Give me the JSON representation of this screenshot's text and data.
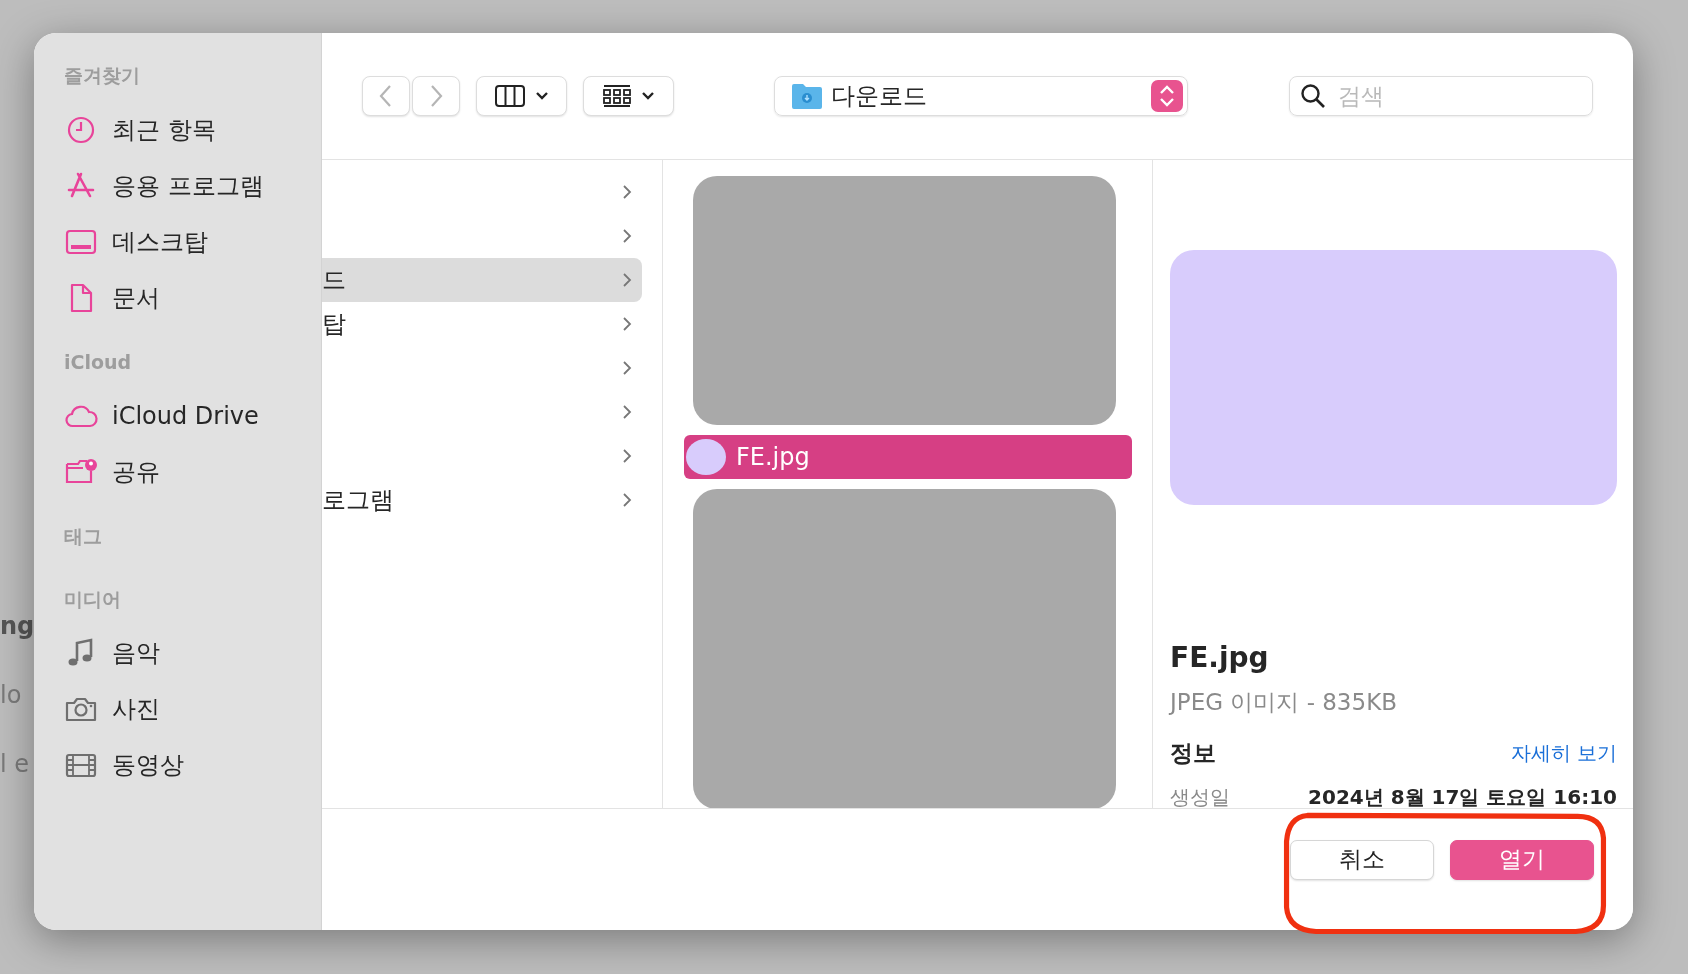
{
  "background_texts": [
    "ng",
    "lo",
    "l e"
  ],
  "sidebar": {
    "sections": [
      {
        "title": "즐겨찾기",
        "items": [
          {
            "label": "최근 항목",
            "kind": "clock"
          },
          {
            "label": "응용 프로그램",
            "kind": "apps"
          },
          {
            "label": "데스크탑",
            "kind": "desktop"
          },
          {
            "label": "문서",
            "kind": "document"
          }
        ]
      },
      {
        "title": "iCloud",
        "items": [
          {
            "label": "iCloud Drive",
            "kind": "cloud"
          },
          {
            "label": "공유",
            "kind": "shared"
          }
        ]
      },
      {
        "title": "태그"
      },
      {
        "title": "미디어",
        "items": [
          {
            "label": "음악",
            "kind": "music"
          },
          {
            "label": "사진",
            "kind": "camera"
          },
          {
            "label": "동영상",
            "kind": "film"
          }
        ]
      }
    ]
  },
  "toolbar": {
    "location": "다운로드",
    "search": {
      "placeholder": "검색"
    }
  },
  "column_1": {
    "rows": [
      {
        "selected": false
      },
      {
        "selected": false
      },
      {
        "label": "드",
        "selected": true
      },
      {
        "label": "탑",
        "selected": false
      },
      {
        "selected": false
      },
      {
        "selected": false
      },
      {
        "selected": false
      },
      {
        "label": "로그램",
        "selected": false
      }
    ]
  },
  "column_2": {
    "items": [
      {
        "kind": "redacted"
      },
      {
        "kind": "file",
        "label": "FE.jpg",
        "selected": true
      },
      {
        "kind": "redacted"
      }
    ]
  },
  "preview": {
    "name": "FE.jpg",
    "description": "JPEG 이미지 - 835KB",
    "info_heading": "정보",
    "more_link": "자세히 보기",
    "fields": [
      {
        "label": "생성일",
        "value": "2024년 8월 17일 토요일 16:10"
      }
    ]
  },
  "buttons": [
    {
      "label": "취소",
      "kind": "cancel"
    },
    {
      "label": "열기",
      "kind": "default"
    }
  ],
  "annotation": {
    "kind": "outline"
  }
}
